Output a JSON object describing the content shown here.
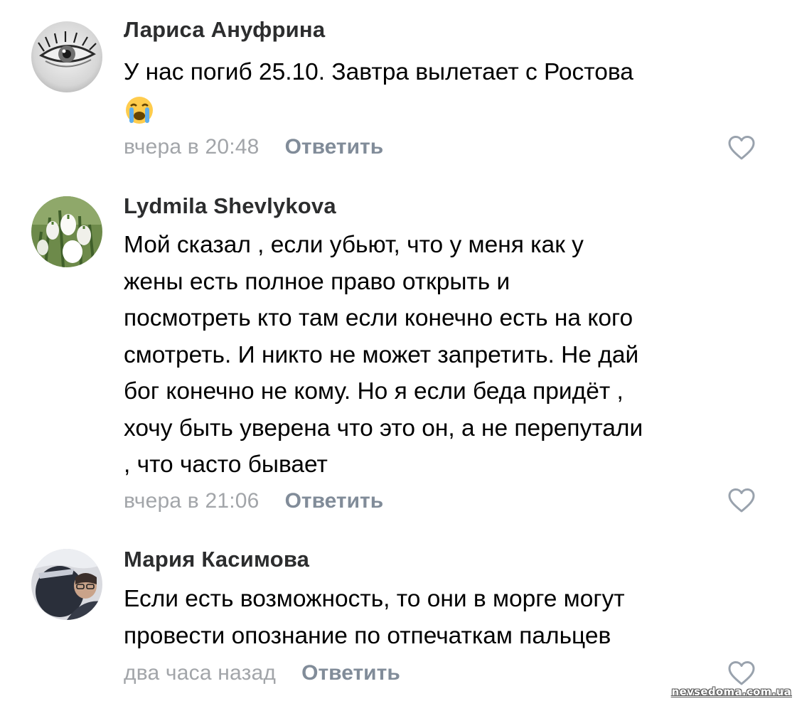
{
  "comments": [
    {
      "author": "Лариса Ануфрина",
      "text_lines": [
        "У нас погиб 25.10. Завтра вылетает с Ростова"
      ],
      "emoji": "loudly-crying-face-emoji",
      "time": "вчера в 20:48",
      "reply_label": "Ответить",
      "avatar": "eye-avatar"
    },
    {
      "author": "Lydmila Shevlykova",
      "text_lines": [
        "Мой сказал , если убьют, что у меня как у",
        "жены есть полное право открыть и",
        "посмотреть кто там если конечно есть на кого",
        "смотреть. И никто не может запретить. Не дай",
        "бог конечно не кому. Но я если  беда придёт ,",
        "хочу быть уверена что это он, а не перепутали",
        ", что часто бывает"
      ],
      "time": "вчера в 21:06",
      "reply_label": "Ответить",
      "avatar": "snowdrop-flowers-avatar"
    },
    {
      "author": "Мария Касимова",
      "text_lines": [
        "Если есть возможность, то они в морге могут",
        "провести опознание по отпечаткам пальцев"
      ],
      "time": "два часа назад",
      "reply_label": "Ответить",
      "avatar": "person-photo-avatar"
    }
  ],
  "watermark": "nevsedoma.com.ua",
  "colors": {
    "author": "#2c2d2e",
    "text": "#000000",
    "time": "#a2a5a9",
    "reply": "#818c99",
    "heart": "#99a2ad"
  },
  "icons": {
    "like": "heart-outline-icon"
  }
}
